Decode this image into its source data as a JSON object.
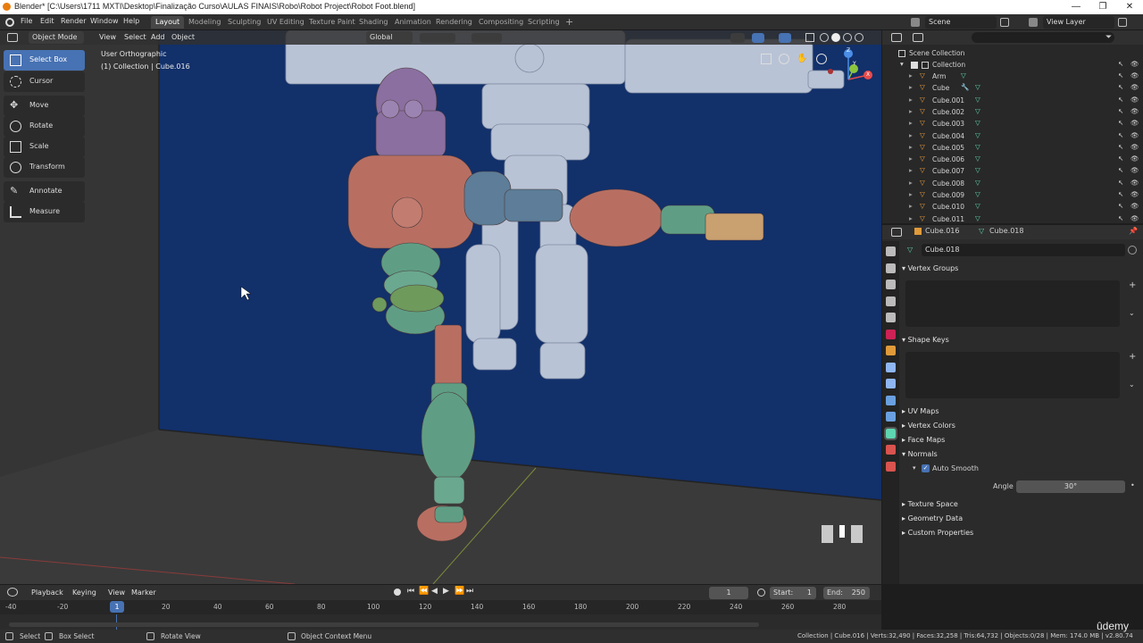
{
  "window": {
    "title": "Blender* [C:\\Users\\1711 MXTI\\Desktop\\Finalização Curso\\AULAS FINAIS\\Robo\\Robot Project\\Robot Foot.blend]",
    "minimize": "—",
    "maximize": "❐",
    "close": "✕"
  },
  "menu": {
    "items": [
      "File",
      "Edit",
      "Render",
      "Window",
      "Help"
    ],
    "workspaces": [
      "Layout",
      "Modeling",
      "Sculpting",
      "UV Editing",
      "Texture Paint",
      "Shading",
      "Animation",
      "Rendering",
      "Compositing",
      "Scripting"
    ],
    "add_workspace": "+",
    "scene": "Scene",
    "view_layer": "View Layer"
  },
  "viewport": {
    "mode": "Object Mode",
    "menus": [
      "View",
      "Select",
      "Add",
      "Object"
    ],
    "orientation": "Global",
    "overlay_title": "User Orthographic",
    "overlay_subtitle": "(1) Collection | Cube.016",
    "tools": [
      {
        "label": "Select Box",
        "icon": "select-box-icon",
        "selected": true
      },
      {
        "label": "Cursor",
        "icon": "cursor-icon",
        "selected": false
      },
      {
        "label": "Move",
        "icon": "move-icon",
        "selected": false
      },
      {
        "label": "Rotate",
        "icon": "rotate-icon",
        "selected": false
      },
      {
        "label": "Scale",
        "icon": "scale-icon",
        "selected": false
      },
      {
        "label": "Transform",
        "icon": "transform-icon",
        "selected": false
      },
      {
        "label": "Annotate",
        "icon": "annotate-icon",
        "selected": false
      },
      {
        "label": "Measure",
        "icon": "measure-icon",
        "selected": false
      }
    ],
    "gizmo": {
      "x": "X",
      "y": "Y",
      "z": "Z"
    }
  },
  "outliner": {
    "root": "Scene Collection",
    "collection": "Collection",
    "objects": [
      "Arm",
      "Cube",
      "Cube.001",
      "Cube.002",
      "Cube.003",
      "Cube.004",
      "Cube.005",
      "Cube.006",
      "Cube.007",
      "Cube.008",
      "Cube.009",
      "Cube.010",
      "Cube.011"
    ]
  },
  "properties": {
    "object_name": "Cube.016",
    "mesh_name": "Cube.018",
    "data_name": "Cube.018",
    "sections": {
      "vertex_groups": "Vertex Groups",
      "shape_keys": "Shape Keys",
      "uv_maps": "UV Maps",
      "vertex_colors": "Vertex Colors",
      "face_maps": "Face Maps",
      "normals": "Normals",
      "auto_smooth": "Auto Smooth",
      "angle_label": "Angle",
      "angle_value": "30°",
      "texture_space": "Texture Space",
      "geometry_data": "Geometry Data",
      "custom_properties": "Custom Properties"
    }
  },
  "timeline": {
    "menus": [
      "Playback",
      "Keying",
      "View",
      "Marker"
    ],
    "current_frame": "1",
    "start_label": "Start:",
    "start": "1",
    "end_label": "End:",
    "end": "250",
    "ticks": [
      "-40",
      "-20",
      "20",
      "40",
      "60",
      "80",
      "100",
      "120",
      "140",
      "160",
      "180",
      "200",
      "220",
      "240",
      "260",
      "280"
    ],
    "cursor_frame": "1"
  },
  "statusbar": {
    "select": "Select",
    "box_select": "Box Select",
    "rotate_view": "Rotate View",
    "context_menu": "Object Context Menu",
    "stats": "Collection | Cube.016 | Verts:32,490 | Faces:32,258 | Tris:64,732 | Objects:0/28 | Mem: 174.0 MB | v2.80.74"
  },
  "watermark": "ûdemy",
  "colors": {
    "accent": "#4772b3",
    "backdrop": "#0f2a5c",
    "robot_head": "#8a6fa0",
    "robot_body": "#b86f62",
    "robot_limb": "#5f9e85"
  }
}
